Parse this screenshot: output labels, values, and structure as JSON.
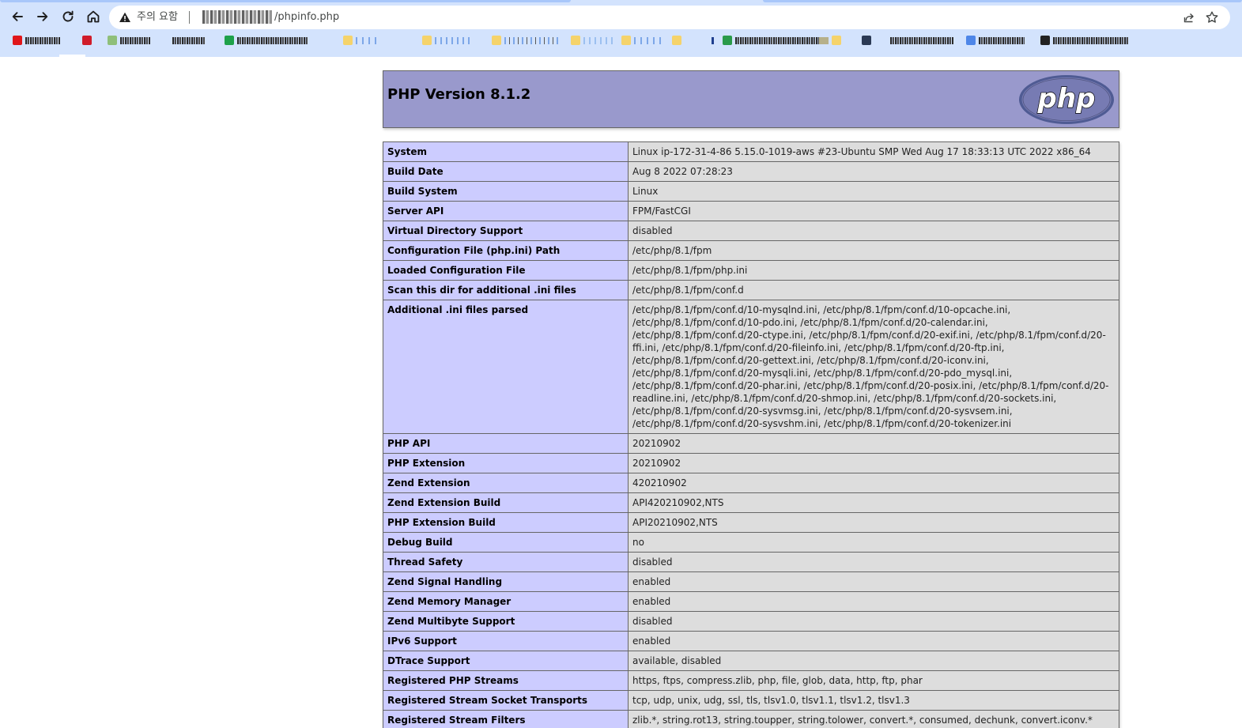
{
  "browser": {
    "security_status": "주의 요함",
    "url_path": "/phpinfo.php"
  },
  "page": {
    "title": "PHP Version 8.1.2",
    "logo_text": "php"
  },
  "rows": [
    {
      "label": "System",
      "value": "Linux ip-172-31-4-86 5.15.0-1019-aws #23-Ubuntu SMP Wed Aug 17 18:33:13 UTC 2022 x86_64"
    },
    {
      "label": "Build Date",
      "value": "Aug 8 2022 07:28:23"
    },
    {
      "label": "Build System",
      "value": "Linux"
    },
    {
      "label": "Server API",
      "value": "FPM/FastCGI"
    },
    {
      "label": "Virtual Directory Support",
      "value": "disabled"
    },
    {
      "label": "Configuration File (php.ini) Path",
      "value": "/etc/php/8.1/fpm"
    },
    {
      "label": "Loaded Configuration File",
      "value": "/etc/php/8.1/fpm/php.ini"
    },
    {
      "label": "Scan this dir for additional .ini files",
      "value": "/etc/php/8.1/fpm/conf.d"
    },
    {
      "label": "Additional .ini files parsed",
      "value": "/etc/php/8.1/fpm/conf.d/10-mysqlnd.ini, /etc/php/8.1/fpm/conf.d/10-opcache.ini, /etc/php/8.1/fpm/conf.d/10-pdo.ini, /etc/php/8.1/fpm/conf.d/20-calendar.ini, /etc/php/8.1/fpm/conf.d/20-ctype.ini, /etc/php/8.1/fpm/conf.d/20-exif.ini, /etc/php/8.1/fpm/conf.d/20-ffi.ini, /etc/php/8.1/fpm/conf.d/20-fileinfo.ini, /etc/php/8.1/fpm/conf.d/20-ftp.ini, /etc/php/8.1/fpm/conf.d/20-gettext.ini, /etc/php/8.1/fpm/conf.d/20-iconv.ini, /etc/php/8.1/fpm/conf.d/20-mysqli.ini, /etc/php/8.1/fpm/conf.d/20-pdo_mysql.ini, /etc/php/8.1/fpm/conf.d/20-phar.ini, /etc/php/8.1/fpm/conf.d/20-posix.ini, /etc/php/8.1/fpm/conf.d/20-readline.ini, /etc/php/8.1/fpm/conf.d/20-shmop.ini, /etc/php/8.1/fpm/conf.d/20-sockets.ini, /etc/php/8.1/fpm/conf.d/20-sysvmsg.ini, /etc/php/8.1/fpm/conf.d/20-sysvsem.ini, /etc/php/8.1/fpm/conf.d/20-sysvshm.ini, /etc/php/8.1/fpm/conf.d/20-tokenizer.ini"
    },
    {
      "label": "PHP API",
      "value": "20210902"
    },
    {
      "label": "PHP Extension",
      "value": "20210902"
    },
    {
      "label": "Zend Extension",
      "value": "420210902"
    },
    {
      "label": "Zend Extension Build",
      "value": "API420210902,NTS"
    },
    {
      "label": "PHP Extension Build",
      "value": "API20210902,NTS"
    },
    {
      "label": "Debug Build",
      "value": "no"
    },
    {
      "label": "Thread Safety",
      "value": "disabled"
    },
    {
      "label": "Zend Signal Handling",
      "value": "enabled"
    },
    {
      "label": "Zend Memory Manager",
      "value": "enabled"
    },
    {
      "label": "Zend Multibyte Support",
      "value": "disabled"
    },
    {
      "label": "IPv6 Support",
      "value": "enabled"
    },
    {
      "label": "DTrace Support",
      "value": "available, disabled"
    },
    {
      "label": "Registered PHP Streams",
      "value": "https, ftps, compress.zlib, php, file, glob, data, http, ftp, phar"
    },
    {
      "label": "Registered Stream Socket Transports",
      "value": "tcp, udp, unix, udg, ssl, tls, tlsv1.0, tlsv1.1, tlsv1.2, tlsv1.3"
    },
    {
      "label": "Registered Stream Filters",
      "value": "zlib.*, string.rot13, string.toupper, string.tolower, convert.*, consumed, dechunk, convert.iconv.*"
    }
  ],
  "colors": {
    "header_bg": "#9999cc",
    "label_bg": "#ccccff",
    "value_bg": "#dddddd",
    "chrome_bg": "#d3e3fd"
  }
}
